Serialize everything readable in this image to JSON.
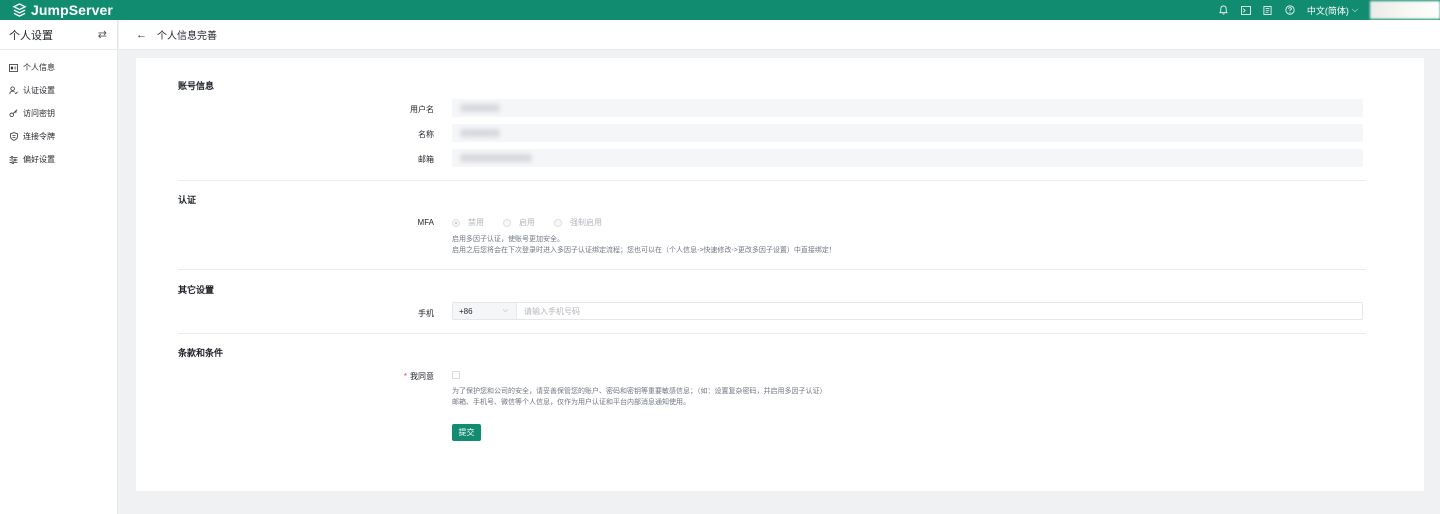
{
  "app": {
    "brand": "JumpServer",
    "accent_color": "#128c70"
  },
  "topbar": {
    "icons": [
      "bell-icon",
      "terminal-icon",
      "clipboard-icon",
      "help-icon"
    ],
    "language": "中文(简体)"
  },
  "sidebar": {
    "title": "个人设置",
    "items": [
      {
        "label": "个人信息",
        "icon": "id-card-icon"
      },
      {
        "label": "认证设置",
        "icon": "user-auth-icon"
      },
      {
        "label": "访问密钥",
        "icon": "key-icon"
      },
      {
        "label": "连接令牌",
        "icon": "token-icon"
      },
      {
        "label": "偏好设置",
        "icon": "sliders-icon"
      }
    ]
  },
  "header": {
    "title": "个人信息完善"
  },
  "form": {
    "account": {
      "title": "账号信息",
      "username_label": "用户名",
      "name_label": "名称",
      "email_label": "邮箱"
    },
    "auth": {
      "title": "认证",
      "mfa_label": "MFA",
      "options": [
        "禁用",
        "启用",
        "强制启用"
      ],
      "selected": "禁用",
      "help_line1": "启用多因子认证，使账号更加安全。",
      "help_line2": "启用之后您将会在下次登录时进入多因子认证绑定流程；您也可以在（个人信息->快速修改->更改多因子设置）中直接绑定！"
    },
    "other": {
      "title": "其它设置",
      "phone_label": "手机",
      "country_code": "+86",
      "phone_placeholder": "请输入手机号码"
    },
    "terms": {
      "title": "条款和条件",
      "agree_label": "我同意",
      "required_mark": "*",
      "agreed": false,
      "help_line1": "为了保护您和公司的安全，请妥善保管您的账户、密码和密钥等重要敏感信息；（如：设置复杂密码，并启用多因子认证）",
      "help_line2": "邮箱、手机号、微信等个人信息，仅作为用户认证和平台内部消息通知使用。",
      "submit_label": "提交"
    }
  }
}
